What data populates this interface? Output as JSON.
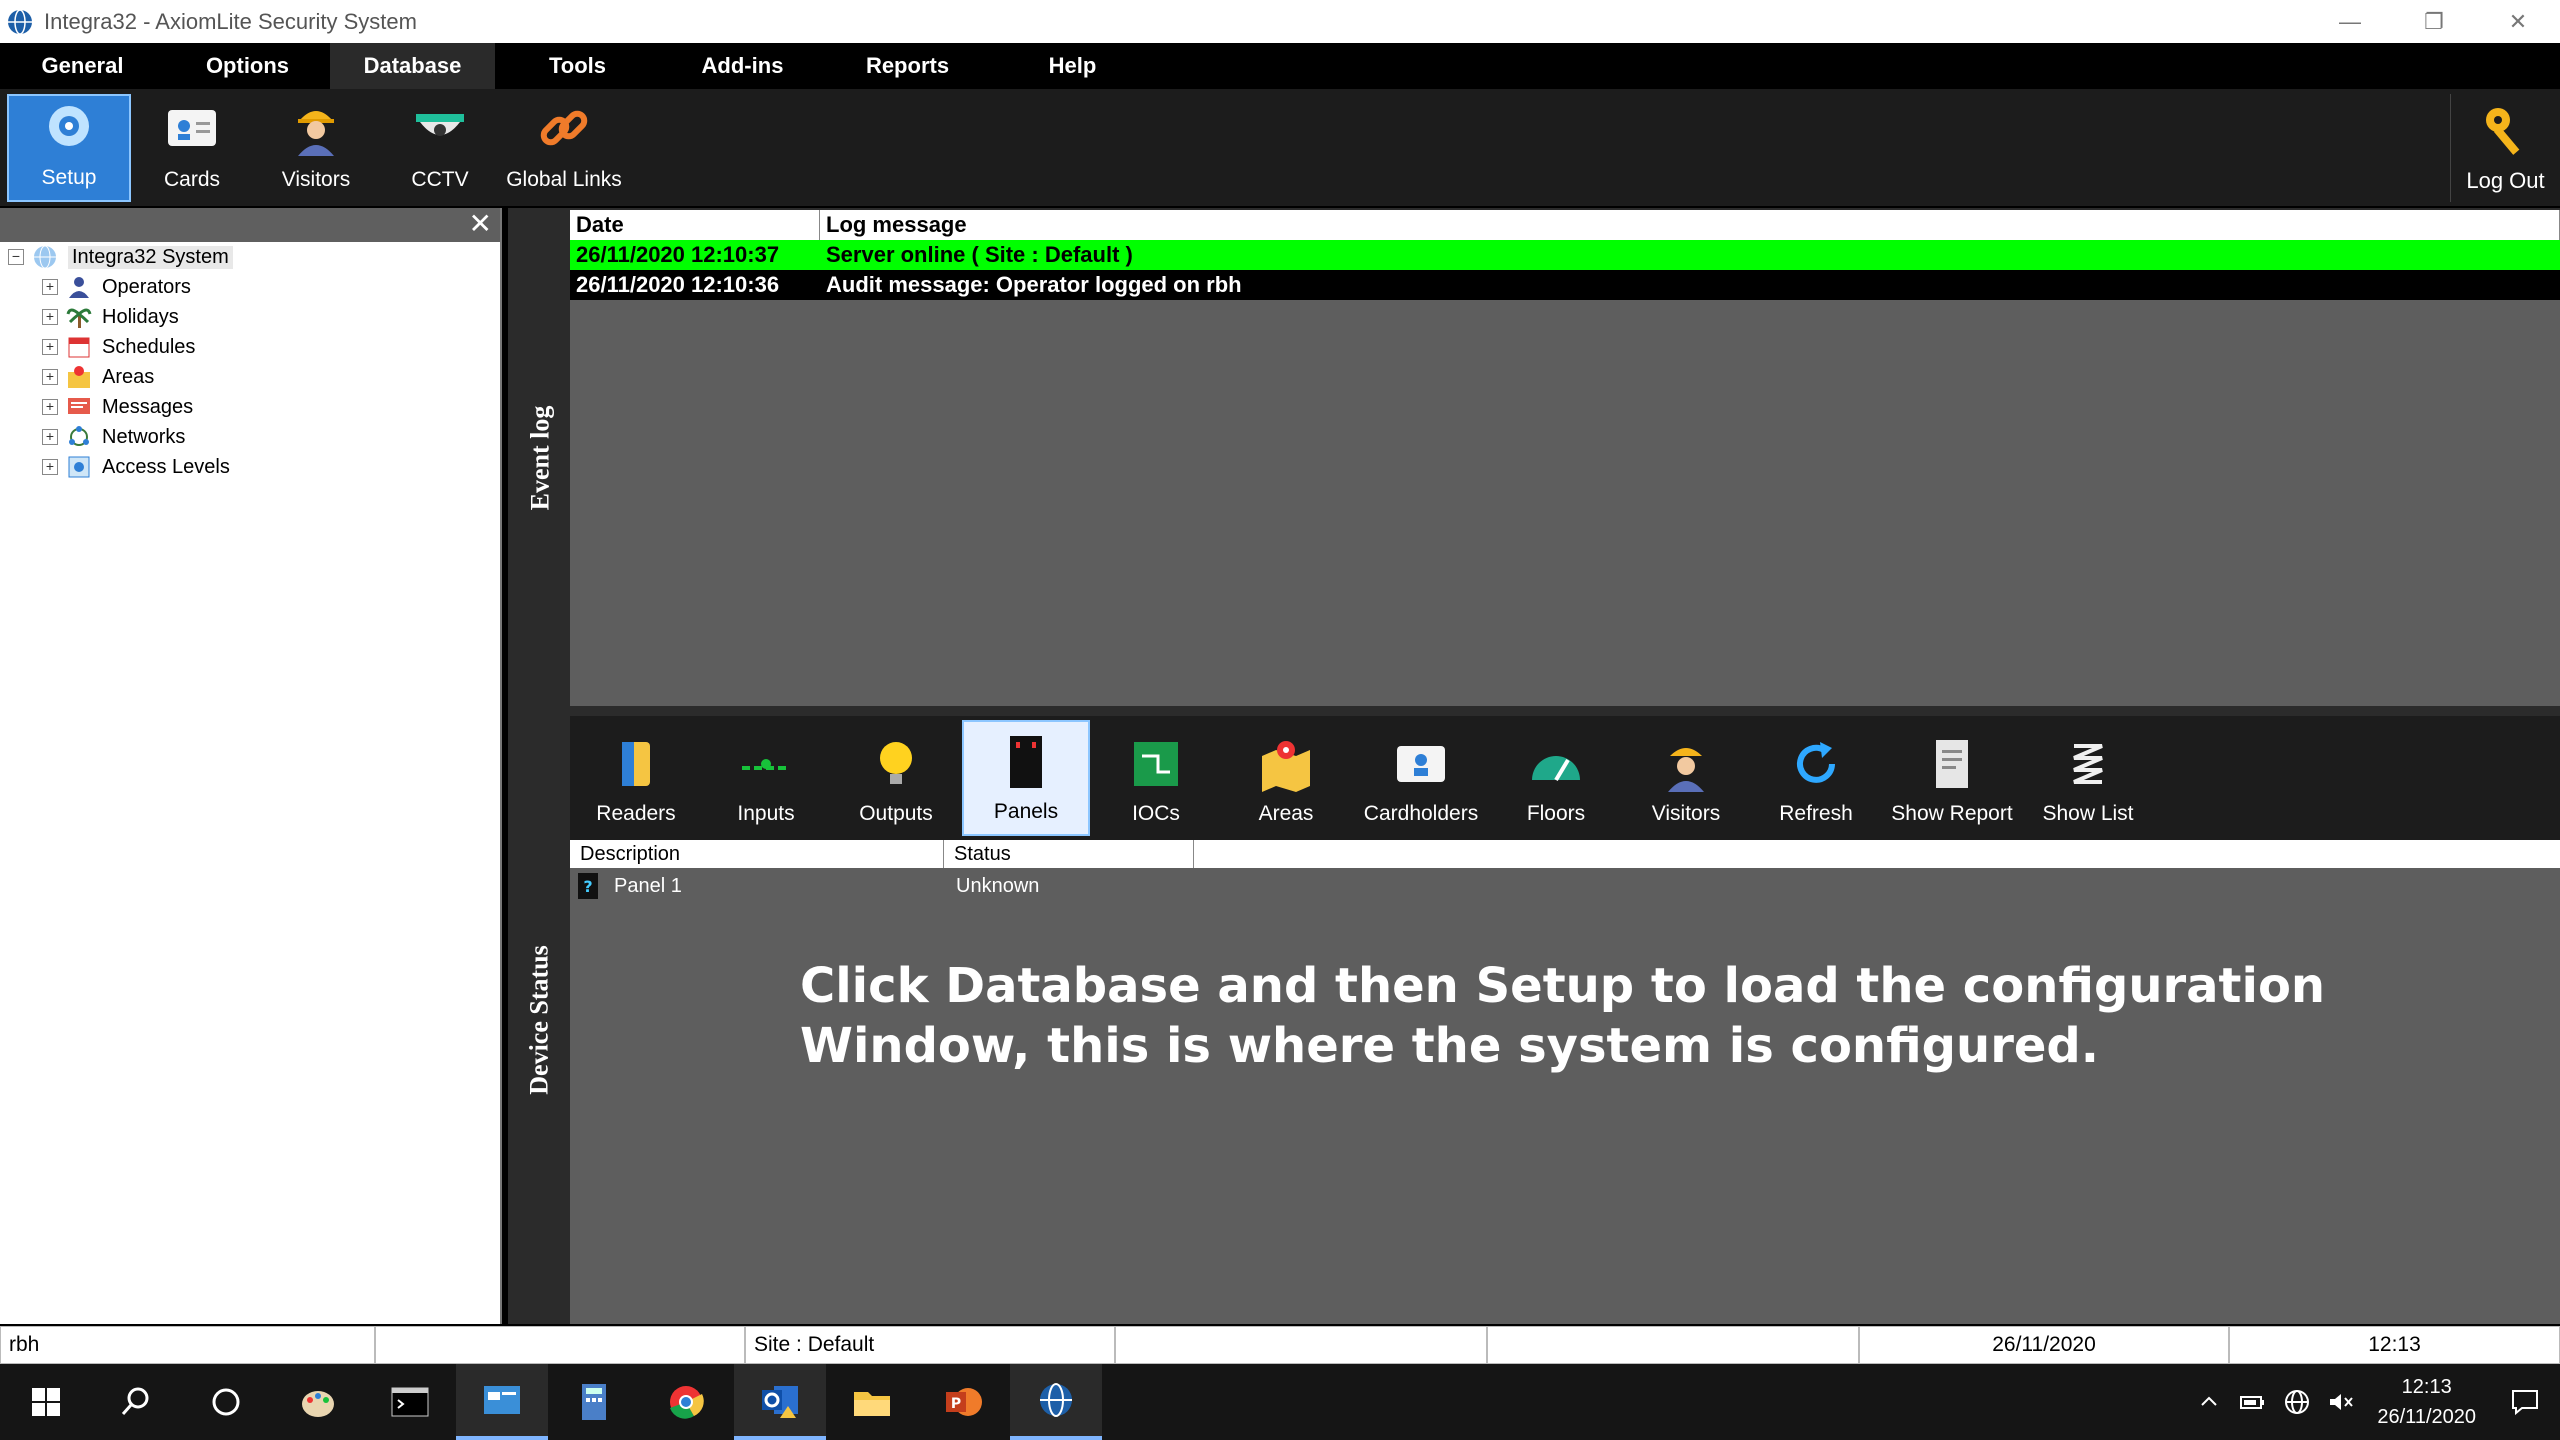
{
  "window": {
    "title": "Integra32 - AxiomLite Security System"
  },
  "menu": [
    "General",
    "Options",
    "Database",
    "Tools",
    "Add-ins",
    "Reports",
    "Help"
  ],
  "ribbon": {
    "setup": "Setup",
    "cards": "Cards",
    "visitors": "Visitors",
    "cctv": "CCTV",
    "global_links": "Global Links",
    "logout": "Log Out"
  },
  "tree": {
    "close": "✕",
    "root": "Integra32 System",
    "items": [
      "Operators",
      "Holidays",
      "Schedules",
      "Areas",
      "Messages",
      "Networks",
      "Access Levels"
    ]
  },
  "event_log": {
    "label": "Event log",
    "col_date": "Date",
    "col_message": "Log message",
    "rows": [
      {
        "date": "26/11/2020 12:10:37",
        "message": "Server online ( Site : Default )"
      },
      {
        "date": "26/11/2020 12:10:36",
        "message": "Audit message: Operator logged on   rbh"
      }
    ],
    "highlight_color": "#00ff00"
  },
  "device_status": {
    "label": "Device Status",
    "toolbar": [
      "Readers",
      "Inputs",
      "Outputs",
      "Panels",
      "IOCs",
      "Areas",
      "Cardholders",
      "Floors",
      "Visitors",
      "Refresh",
      "Show Report",
      "Show List"
    ],
    "selected": "Panels",
    "col_description": "Description",
    "col_status": "Status",
    "row": {
      "description": "Panel 1",
      "status": "Unknown"
    },
    "instruction": "Click Database and then Setup to load the configuration Window, this is where the system is configured."
  },
  "statusbar": {
    "user": "rbh",
    "site": "Site : Default",
    "date": "26/11/2020",
    "time": "12:13"
  },
  "taskbar": {
    "time": "12:13",
    "date": "26/11/2020"
  },
  "colors": {
    "accent": "#2e7fd6",
    "panel": "#5e5e5e",
    "menu": "#000000"
  }
}
